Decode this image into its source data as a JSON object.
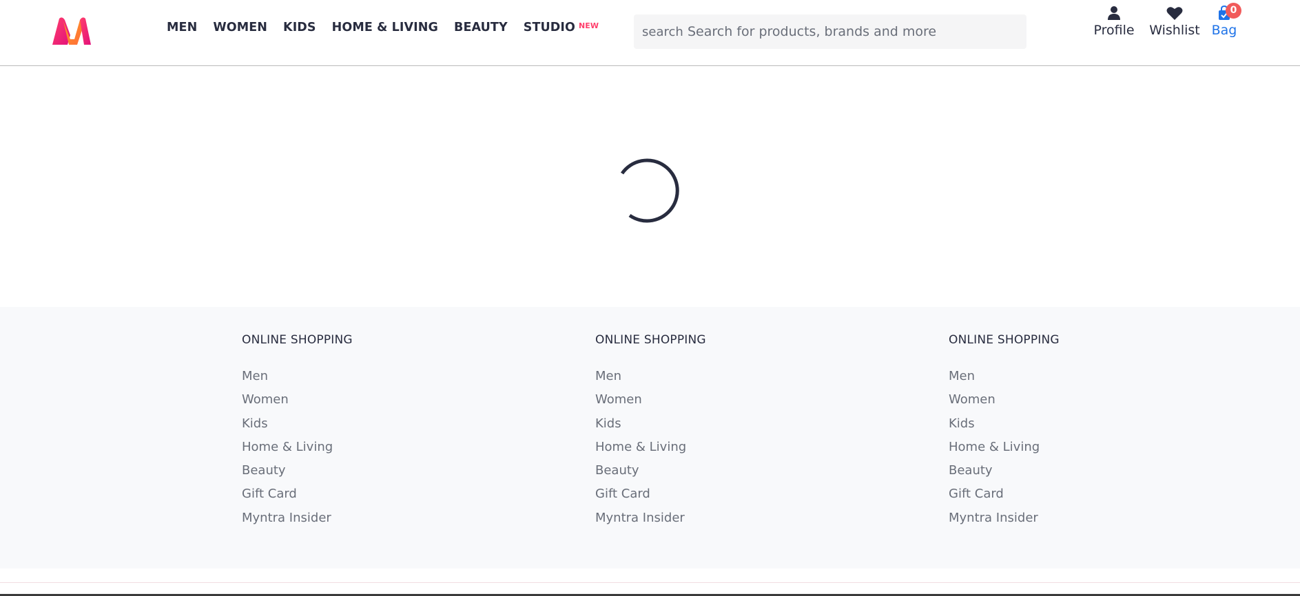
{
  "header": {
    "nav": [
      {
        "label": "MEN"
      },
      {
        "label": "WOMEN"
      },
      {
        "label": "KIDS"
      },
      {
        "label": "HOME & LIVING"
      },
      {
        "label": "BEAUTY"
      },
      {
        "label": "STUDIO",
        "badge": "NEW"
      }
    ],
    "search": {
      "icon_text": "search",
      "placeholder": "Search for products, brands and more"
    },
    "actions": {
      "profile": "Profile",
      "wishlist": "Wishlist",
      "bag": "Bag",
      "bag_count": "0"
    }
  },
  "footer": {
    "columns": [
      {
        "heading": "ONLINE SHOPPING",
        "links": [
          "Men",
          "Women",
          "Kids",
          "Home & Living",
          "Beauty",
          "Gift Card",
          "Myntra Insider"
        ]
      },
      {
        "heading": "ONLINE SHOPPING",
        "links": [
          "Men",
          "Women",
          "Kids",
          "Home & Living",
          "Beauty",
          "Gift Card",
          "Myntra Insider"
        ]
      },
      {
        "heading": "ONLINE SHOPPING",
        "links": [
          "Men",
          "Women",
          "Kids",
          "Home & Living",
          "Beauty",
          "Gift Card",
          "Myntra Insider"
        ]
      }
    ]
  },
  "colors": {
    "brand_pink": "#ff3f6c",
    "bag_blue": "#1f73e8",
    "badge_red": "#f15b5b",
    "footer_bg": "#f8f9fb"
  },
  "icons": {
    "logo": "myntra-logo",
    "profile": "person-icon",
    "wishlist": "heart-icon",
    "bag": "shopping-bag-icon",
    "loader": "loading-spinner"
  }
}
